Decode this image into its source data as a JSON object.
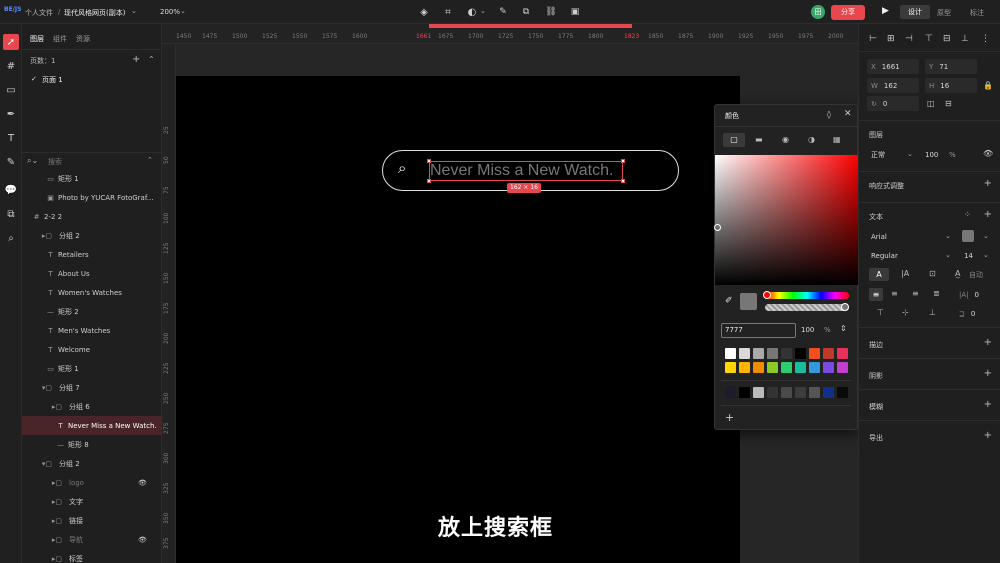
{
  "topbar": {
    "logo_text": "BE/JS",
    "breadcrumb_root": "个人文件",
    "separator": "/",
    "file_name": "现代风格网页(副本)",
    "zoom": "200%",
    "avatar_letter": "田",
    "share_label": "分享",
    "mode_tabs": [
      "设计",
      "原型",
      "标注"
    ]
  },
  "layers_panel": {
    "tabs": [
      "图层",
      "组件",
      "资源"
    ],
    "pages_label": "页数：1",
    "page_item": "页面 1",
    "search_placeholder": "搜索",
    "items": [
      {
        "label": "矩形 1",
        "glyph": "▭"
      },
      {
        "label": "Photo by YUCAR FotoGraf...",
        "glyph": "▣"
      },
      {
        "label": "2-2 2",
        "glyph": "#"
      },
      {
        "label": "分组 2",
        "glyph": "▸▢"
      },
      {
        "label": "Retailers",
        "glyph": "T"
      },
      {
        "label": "About Us",
        "glyph": "T"
      },
      {
        "label": "Women's Watches",
        "glyph": "T"
      },
      {
        "label": "矩形 2",
        "glyph": "—"
      },
      {
        "label": "Men's Watches",
        "glyph": "T"
      },
      {
        "label": "Welcome",
        "glyph": "T"
      },
      {
        "label": "矩形 1",
        "glyph": "▭"
      },
      {
        "label": "分组 7",
        "glyph": "▾▢"
      },
      {
        "label": "分组 6",
        "glyph": "▸▢"
      },
      {
        "label": "Never Miss a New Watch.",
        "glyph": "T"
      },
      {
        "label": "矩形 8",
        "glyph": "—"
      },
      {
        "label": "分组 2",
        "glyph": "▾▢"
      },
      {
        "label": "logo",
        "glyph": "▸▢"
      },
      {
        "label": "文字",
        "glyph": "▸▢"
      },
      {
        "label": "链接",
        "glyph": "▸▢"
      },
      {
        "label": "导航",
        "glyph": "▸▢"
      },
      {
        "label": "标签",
        "glyph": "▸▢"
      }
    ]
  },
  "ruler": {
    "h_ticks": [
      "1450",
      "1475",
      "1500",
      "1525",
      "1550",
      "1575",
      "1600",
      "1661",
      "1675",
      "1700",
      "1725",
      "1750",
      "1775",
      "1800",
      "1823",
      "1850",
      "1875",
      "1900",
      "1925",
      "1950",
      "1975",
      "2000"
    ],
    "v_ticks": [
      "25",
      "50",
      "75",
      "100",
      "125",
      "150",
      "175",
      "200",
      "225",
      "250",
      "275",
      "300",
      "325",
      "350",
      "375",
      "400"
    ]
  },
  "canvas": {
    "search_text": "Never Miss a New Watch.",
    "size_badge": "162 × 16",
    "subtitle": "放上搜索框"
  },
  "color_picker": {
    "title": "颜色",
    "hex_value": "7777",
    "opacity": "100",
    "percent": "%",
    "add": "+",
    "swatch_row1": [
      "#ffffff",
      "#d9d9d9",
      "#aaaaaa",
      "#777777",
      "#333333",
      "#000000",
      "#f24e1e",
      "#c0392b",
      "#e8305c"
    ],
    "swatch_row2": [
      "#ffd600",
      "#ffb400",
      "#f08c00",
      "#8ac926",
      "#2ecc71",
      "#1abc9c",
      "#3498db",
      "#7b4ae2",
      "#c13fd1"
    ],
    "swatch_row3": [
      "#1c1c2e",
      "#000000",
      "#bbbbbb",
      "#333333",
      "#4a4a4a",
      "#3d3d3d",
      "#555555",
      "#10308a",
      "#0a0a0a"
    ]
  },
  "props_panel": {
    "x": "1661",
    "y": "71",
    "w": "162",
    "h": "16",
    "rotation": "0",
    "layer_section": "图层",
    "blend": "正常",
    "opacity": "100",
    "opacity_unit": "%",
    "responsive": "响应式调整",
    "text_section": "文本",
    "font": "Arial",
    "weight": "Regular",
    "size": "14",
    "auto": "自动",
    "spacing1": "0",
    "spacing2": "0",
    "stroke": "描边",
    "shadow": "阴影",
    "blur": "模糊",
    "export": "导出"
  },
  "colors": {
    "accent": "#e8474d",
    "selection": "#e8474d"
  }
}
